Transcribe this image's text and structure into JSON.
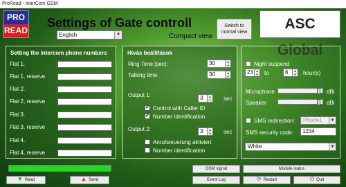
{
  "window": {
    "title": "ProRead - InterCom GSM"
  },
  "logo": {
    "top": "PRO",
    "bottom": "READ"
  },
  "header": {
    "title": "Settings of Gate controll",
    "language": "English",
    "view_label": "Compact view",
    "switch_button": "Switch to normal view",
    "brand": "ASC Global"
  },
  "phone_numbers": {
    "title": "Setting the intercom phone numbers",
    "flats": [
      {
        "label": "Flat 1.",
        "value": ""
      },
      {
        "label": "Flat 1, reserve",
        "value": ""
      },
      {
        "label": "Flat 2.",
        "value": ""
      },
      {
        "label": "Flat 2, reserve",
        "value": ""
      },
      {
        "label": "Flat 3.",
        "value": ""
      },
      {
        "label": "Flat 3, reserve",
        "value": ""
      },
      {
        "label": "Flat 4.",
        "value": ""
      },
      {
        "label": "Flat 4, reserve",
        "value": ""
      }
    ]
  },
  "call_settings": {
    "title": "Hívás beállítások",
    "ring_time_label": "Ring Time [sec]:",
    "ring_time": "30",
    "talking_time_label": "Talking time",
    "talking_time": "30",
    "output1": {
      "label": "Output 1:",
      "value": "3",
      "unit": "sec",
      "options": [
        {
          "label": "Control with Caller ID",
          "checked": true
        },
        {
          "label": "Number identification",
          "checked": true
        }
      ]
    },
    "output2": {
      "label": "Output 2:",
      "value": "3",
      "unit": "sec",
      "options": [
        {
          "label": "Anrufsteuerung aktiviert",
          "checked": false
        },
        {
          "label": "Number identification",
          "checked": false
        }
      ]
    }
  },
  "device": {
    "night_suspend_label": "Night suspend",
    "night_suspend_checked": false,
    "night_from": "23",
    "to_label": "to",
    "night_to": "6",
    "hours_label": "hour(s)",
    "microphone_label": "Microphone",
    "microphone_level": 0.95,
    "speaker_label": "Speaker",
    "speaker_level": 0.95,
    "dbi_unit": "dBi",
    "sms_redirection_label": "SMS redirection:",
    "sms_redirection_checked": false,
    "sms_redirection_target": "Phone1",
    "sms_code_label": "SMS security code:",
    "sms_code": "1234",
    "color_theme": "White"
  },
  "footer": {
    "progress": 1.0,
    "buttons": {
      "read": "Read",
      "send": "Send",
      "gsm_signal": "GSM signal",
      "module_status": "Module status",
      "event_log": "Event Log",
      "restart": "Restart",
      "quit": "Quit"
    }
  },
  "colors": {
    "progress": "#1cdc1c",
    "pro_logo": "#2e2c9c",
    "read_logo": "#e31a1a",
    "background": "#4e9a2c"
  }
}
